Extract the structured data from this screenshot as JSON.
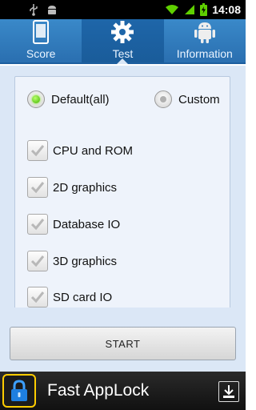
{
  "status_bar": {
    "time": "14:08",
    "icons": [
      "usb-icon",
      "android-debug-icon",
      "wifi-icon",
      "signal-icon",
      "battery-charging-icon"
    ]
  },
  "tabs": [
    {
      "label": "Score",
      "icon": "phone-icon",
      "active": false
    },
    {
      "label": "Test",
      "icon": "gear-icon",
      "active": true
    },
    {
      "label": "Information",
      "icon": "android-icon",
      "active": false
    }
  ],
  "test_options": {
    "radios": [
      {
        "label": "Default(all)",
        "selected": true
      },
      {
        "label": "Custom",
        "selected": false
      }
    ],
    "checkboxes": [
      {
        "label": "CPU and ROM",
        "checked": true
      },
      {
        "label": "2D graphics",
        "checked": true
      },
      {
        "label": "Database IO",
        "checked": true
      },
      {
        "label": "3D graphics",
        "checked": true
      },
      {
        "label": "SD card IO",
        "checked": true
      }
    ]
  },
  "start_button": {
    "label": "START"
  },
  "ad_banner": {
    "title": "Fast AppLock",
    "icon": "lock-icon",
    "action_icon": "download-icon"
  },
  "colors": {
    "tab_bar": "#2a6fb0",
    "tab_active": "#1a5c9a",
    "content_background": "#dbe7f6",
    "radio_selected": "#3fb500"
  }
}
